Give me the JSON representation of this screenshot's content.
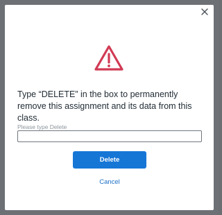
{
  "dialog": {
    "close_icon": "close-icon",
    "warning_icon": "warning-triangle-icon",
    "message": "Type “DELETE” in the box to permanently remove this assignment and its data from this class.",
    "input_label": "Please type Delete",
    "input_value": "",
    "delete_label": "Delete",
    "cancel_label": "Cancel"
  },
  "colors": {
    "warning": "#d13a54",
    "primary": "#1676d6",
    "link": "#1a6fc7",
    "backdrop": "#6d7074"
  }
}
